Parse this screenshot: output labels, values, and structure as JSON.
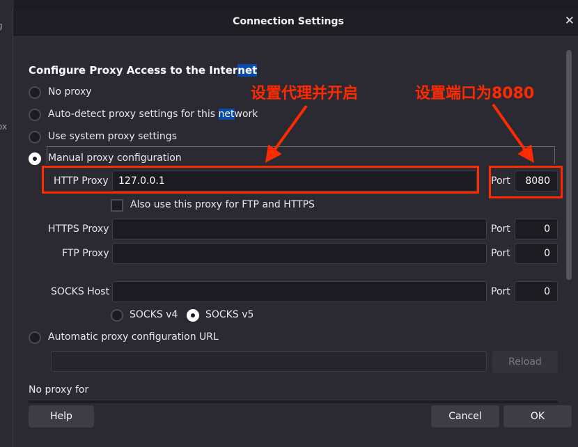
{
  "background_fragments": [
    "g",
    "ox"
  ],
  "window": {
    "title": "Connection Settings",
    "close_icon": "close-icon"
  },
  "heading": {
    "text_before": "Configure Proxy Access to the Inter",
    "text_highlight": "net"
  },
  "options": {
    "no_proxy": "No proxy",
    "auto_detect_before": "Auto-detect proxy settings for this ",
    "auto_detect_highlight": "net",
    "auto_detect_after": "work",
    "system": "Use system proxy settings",
    "manual": "Manual proxy configuration",
    "auto_url": "Automatic proxy configuration URL",
    "selected": "Manual proxy configuration"
  },
  "http": {
    "label": "HTTP Proxy",
    "value": "127.0.0.1",
    "port_label": "Port",
    "port": "8080"
  },
  "also_use": {
    "label": "Also use this proxy for FTP and HTTPS",
    "checked": false
  },
  "https": {
    "label": "HTTPS Proxy",
    "value": "",
    "port_label": "Port",
    "port": "0"
  },
  "ftp": {
    "label": "FTP Proxy",
    "value": "",
    "port_label": "Port",
    "port": "0"
  },
  "socks": {
    "label": "SOCKS Host",
    "value": "",
    "port_label": "Port",
    "port": "0",
    "v4": "SOCKS v4",
    "v5": "SOCKS v5",
    "selected": "SOCKS v5"
  },
  "auto_url": {
    "value": "",
    "reload": "Reload"
  },
  "no_proxy_for": "No proxy for",
  "buttons": {
    "help": "Help",
    "cancel": "Cancel",
    "ok": "OK"
  },
  "annotations": {
    "left": "设置代理并开启",
    "right": "设置端口为8080",
    "color": "#ff2a00"
  }
}
